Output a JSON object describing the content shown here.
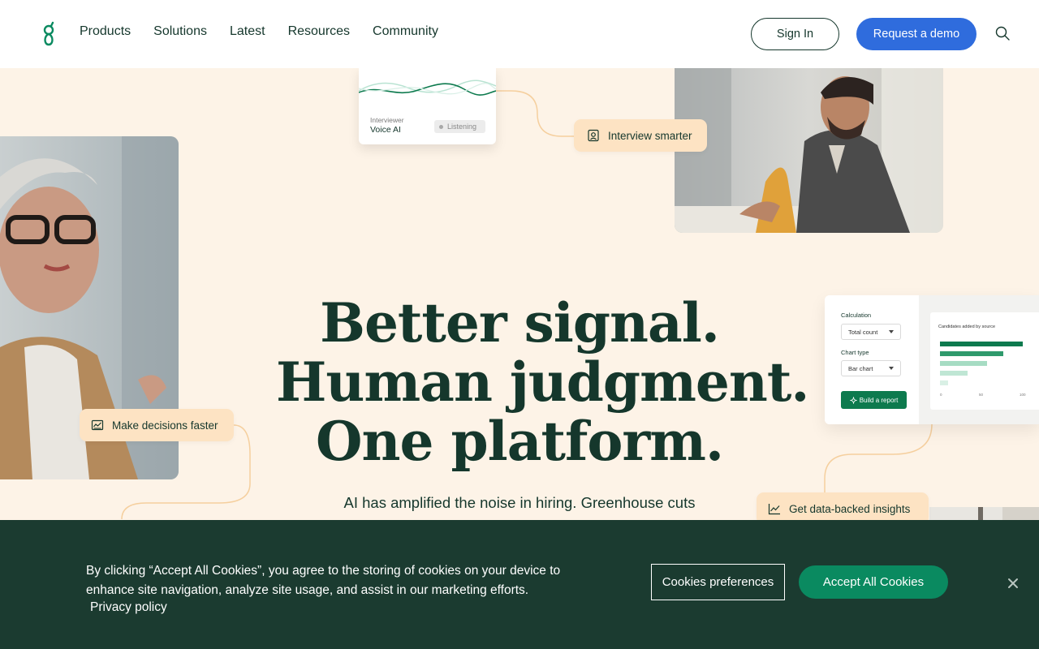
{
  "nav": {
    "links": [
      "Products",
      "Solutions",
      "Latest",
      "Resources",
      "Community"
    ],
    "sign_in": "Sign In",
    "demo": "Request a demo",
    "logo_icon": "greenhouse-logo",
    "search_icon": "search-icon"
  },
  "voice_card": {
    "sub": "Interviewer",
    "title": "Voice AI",
    "status": "Listening"
  },
  "pills": {
    "interview": "Interview smarter",
    "decide": "Make decisions faster",
    "insights": "Get data-backed insights"
  },
  "report": {
    "calc_label": "Calculation",
    "calc_value": "Total count",
    "type_label": "Chart type",
    "type_value": "Bar chart",
    "button": "Build a report",
    "chart_title": "Candidates added by source",
    "ticks": [
      "0",
      "50",
      "100"
    ]
  },
  "hero": {
    "line1": "Better signal.",
    "line2": "Human judgment.",
    "line3": "One platform.",
    "sub": "AI has amplified the noise in hiring. Greenhouse cuts"
  },
  "cookie": {
    "text": "By clicking “Accept All Cookies”, you agree to the storing of cookies on your device to enhance site navigation, analyze site usage, and assist in our marketing efforts.",
    "link": "Privacy policy",
    "prefs": "Cookies preferences",
    "accept": "Accept All Cookies"
  },
  "colors": {
    "brand_green": "#15372c",
    "accent_blue": "#2f6cdd",
    "cookie_bg": "#1b3b30",
    "accept_green": "#0a8a60",
    "hero_bg": "#fdf3e7",
    "pill_bg": "#fde3c3"
  }
}
